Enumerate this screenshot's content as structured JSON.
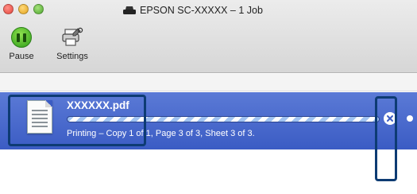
{
  "window": {
    "title": "EPSON SC-XXXXX – 1 Job"
  },
  "toolbar": {
    "pause_label": "Pause",
    "settings_label": "Settings"
  },
  "job": {
    "name": "XXXXXX.pdf",
    "status": "Printing – Copy 1 of 1, Page 3 of 3, Sheet 3 of 3."
  },
  "colors": {
    "selection": "#3b5cc4",
    "callout": "#0d3b73",
    "pause_green": "#2d9d18"
  }
}
